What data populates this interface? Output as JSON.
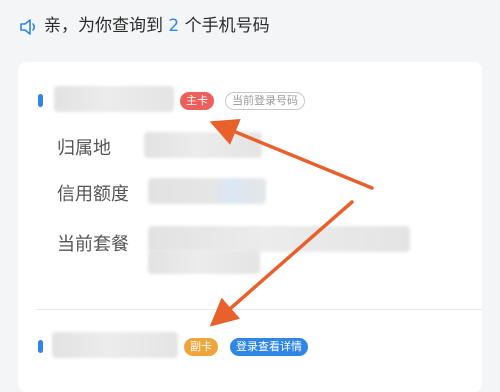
{
  "header": {
    "prefix": "亲，为你查询到",
    "count": "2",
    "suffix": "个手机号码"
  },
  "primary": {
    "tag_main": "主卡",
    "tag_current": "当前登录号码",
    "labels": {
      "region": "归属地",
      "credit": "信用额度",
      "plan": "当前套餐"
    }
  },
  "secondary": {
    "tag_sub": "副卡",
    "tag_action": "登录查看详情"
  },
  "colors": {
    "accent": "#2f86e6",
    "primary_tag": "#ee5f5b",
    "secondary_tag": "#f0a53a",
    "annotation_arrow": "#e8602c"
  }
}
